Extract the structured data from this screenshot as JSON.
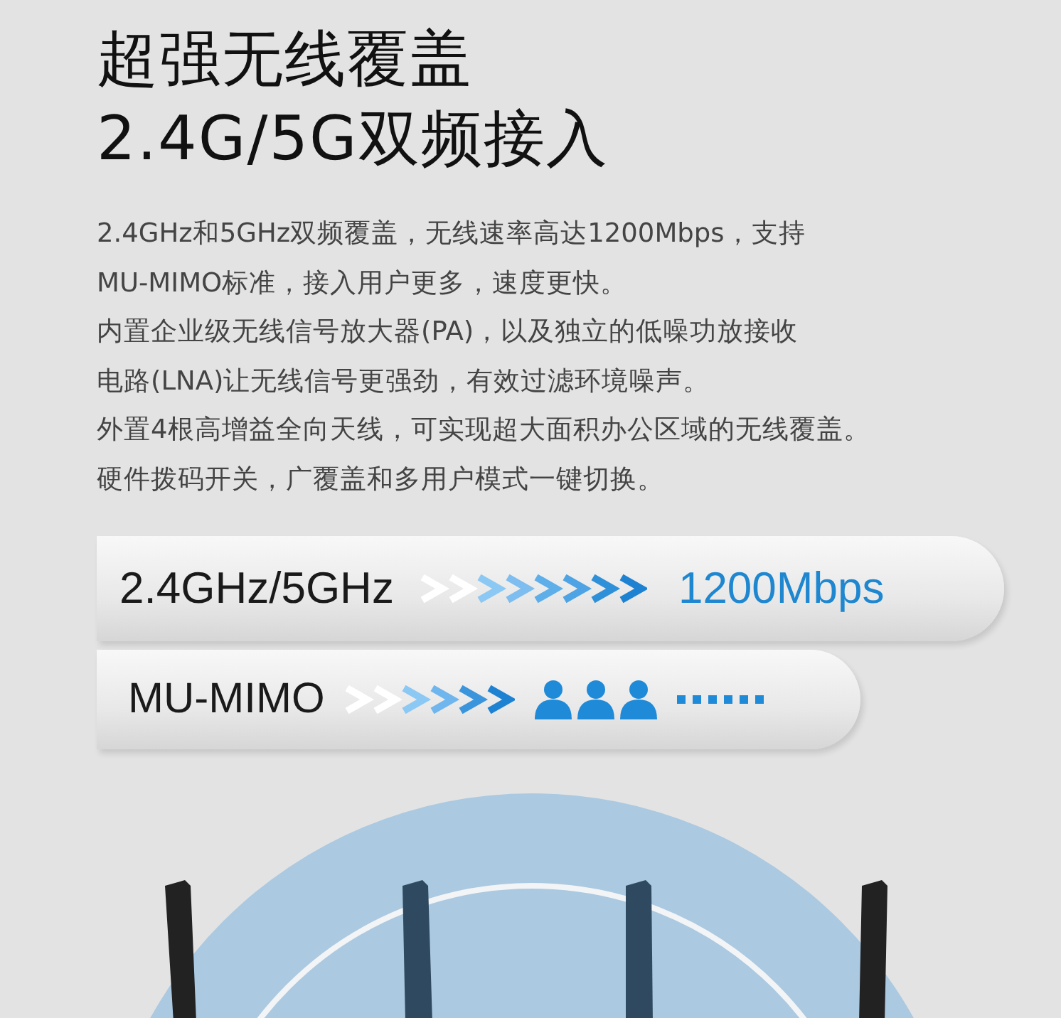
{
  "headline": [
    "超强无线覆盖",
    "2.4G/5G双频接入"
  ],
  "description": [
    "2.4GHz和5GHz双频覆盖，无线速率高达1200Mbps，支持",
    "MU-MIMO标准，接入用户更多，速度更快。",
    "内置企业级无线信号放大器(PA)，以及独立的低噪功放接收",
    "电路(LNA)让无线信号更强劲，有效过滤环境噪声。",
    "外置4根高增益全向天线，可实现超大面积办公区域的无线覆盖。",
    "硬件拨码开关，广覆盖和多用户模式一键切换。"
  ],
  "feature_bars": [
    {
      "kind": "speed",
      "label": "2.4GHz/5GHz",
      "value": "1200Mbps"
    },
    {
      "kind": "users",
      "label": "MU-MIMO"
    }
  ]
}
